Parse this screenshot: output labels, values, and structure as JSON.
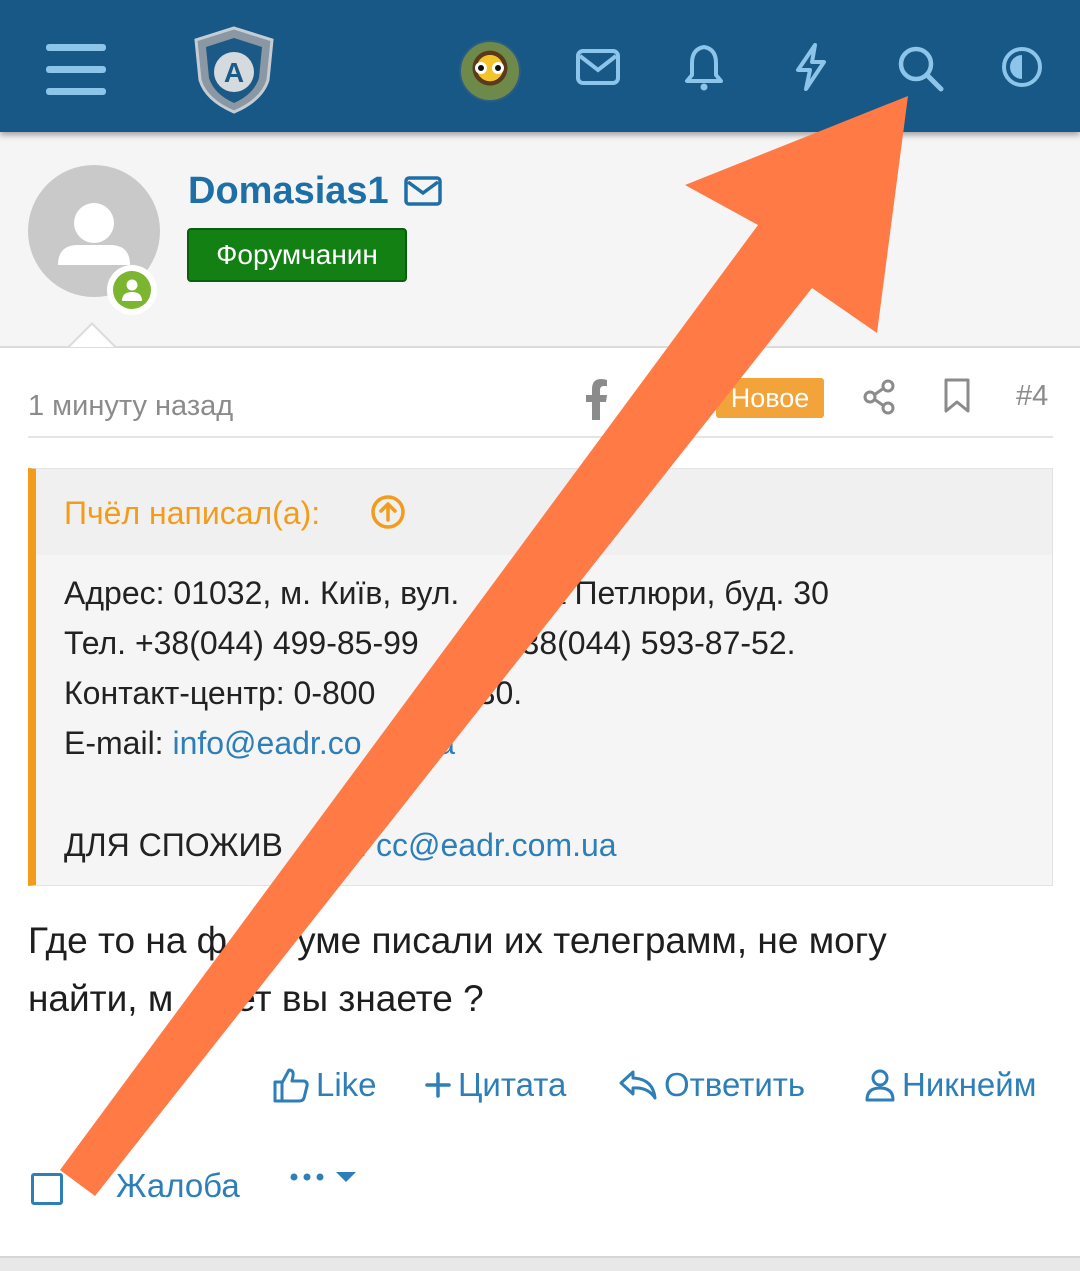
{
  "header": {
    "icons": [
      "menu-icon",
      "shield-logo",
      "avatar",
      "mail-icon",
      "bell-icon",
      "bolt-icon",
      "search-icon",
      "theme-toggle-icon"
    ],
    "logo_letter": "A"
  },
  "profile": {
    "username": "Domasias1",
    "role": "Форумчанин"
  },
  "post_meta": {
    "time": "1 минуту назад",
    "new_label": "Новое",
    "post_number": "#4"
  },
  "quote": {
    "author": "Пчёл написал(а):",
    "line1": "Адрес: 01032, м. Київ, вул.",
    "line1b": "лона Петлюри, буд. 30",
    "line2": "Тел. +38(044) 499-85-99",
    "line2b": "кс: +38(044) 593-87-52.",
    "line3": "Контакт-центр: 0-800",
    "line3b": "23-30.",
    "line4_label": "E-mail: ",
    "line4_link": "info@eadr.co",
    "line4_link_b": "ua",
    "line6_label": "ДЛЯ СПОЖИВ",
    "line6_label_b": "В: ",
    "line6_link": "cc@eadr.com.ua"
  },
  "post": {
    "text_line1a": "Где то на ф",
    "text_line1b": "уме писали их телеграмм, не могу",
    "text_line2a": "найти, м",
    "text_line2b": "ет вы знаете ?"
  },
  "actions": {
    "like": "Like",
    "quote": "Цитата",
    "reply": "Ответить",
    "nickname": "Никнейм",
    "report": "Жалоба"
  },
  "colors": {
    "header_bg": "#185886",
    "link": "#2e7fb8",
    "role_badge": "#138013",
    "new_badge": "#f2a33a",
    "quote_accent": "#f39c1b",
    "arrow": "#ff7a45"
  }
}
